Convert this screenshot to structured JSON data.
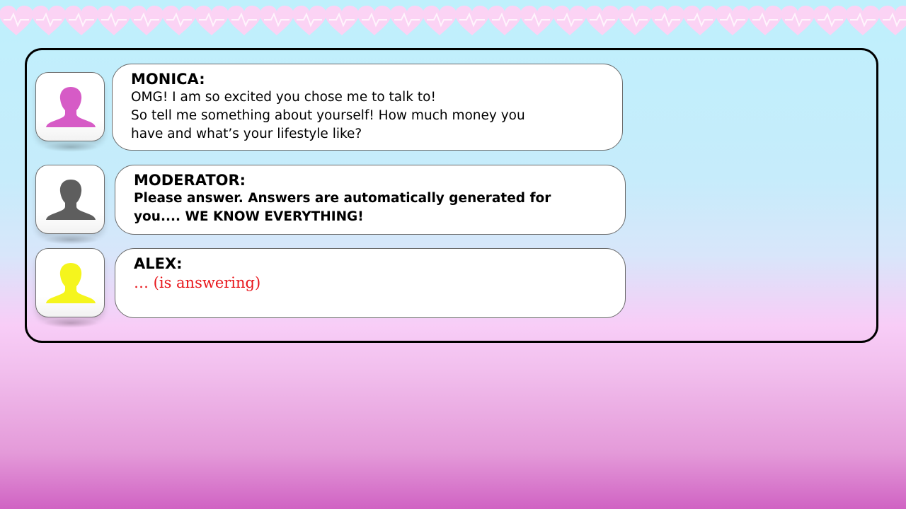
{
  "colors": {
    "monica_avatar": "#d65bc6",
    "moderator_avatar": "#5e5e5e",
    "alex_avatar": "#f5f51d",
    "answering_text": "#e8161b",
    "heart_border": "#fbd3f4"
  },
  "messages": [
    {
      "speaker": "MONICA:",
      "avatar_icon": "person-silhouette-icon",
      "lines": [
        "OMG! I am so excited you chose me to talk to!",
        "So tell me something about yourself! How much money you",
        "have and what’s your lifestyle like?"
      ]
    },
    {
      "speaker": "MODERATOR:",
      "avatar_icon": "person-silhouette-icon",
      "lines": [
        "Please answer. Answers are automatically generated for",
        "you.... WE KNOW EVERYTHING!"
      ]
    },
    {
      "speaker": "ALEX:",
      "avatar_icon": "person-silhouette-icon",
      "lines": [
        "… (is answering)"
      ]
    }
  ]
}
